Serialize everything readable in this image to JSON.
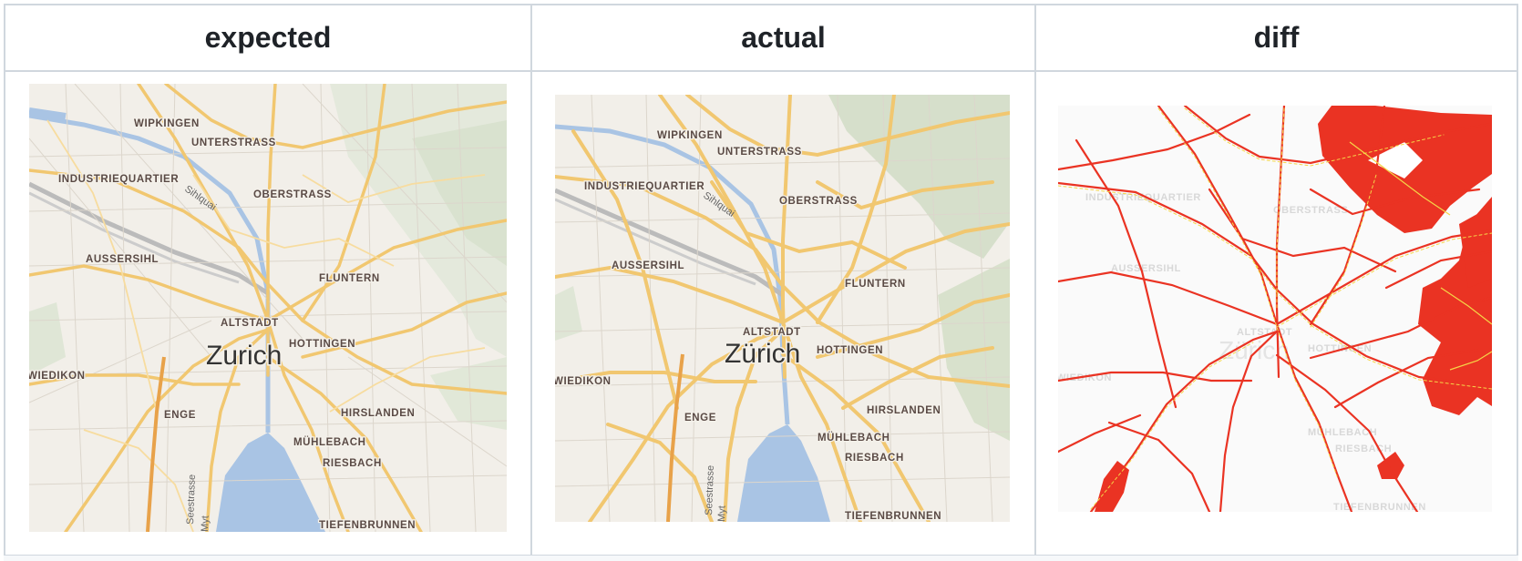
{
  "columns": [
    {
      "id": "expected",
      "label": "expected"
    },
    {
      "id": "actual",
      "label": "actual"
    },
    {
      "id": "diff",
      "label": "diff"
    }
  ],
  "expected_map": {
    "city": "Zurich",
    "street_labels": [
      "Sihlquai",
      "Seestrasse",
      "Myt"
    ],
    "districts": [
      "WIPKINGEN",
      "UNTERSTRASS",
      "INDUSTRIEQUARTIER",
      "OBERSTRASS",
      "AUSSERSIHL",
      "FLUNTERN",
      "ALTSTADT",
      "HOTTINGEN",
      "WIEDIKON",
      "ENGE",
      "HIRSLANDEN",
      "MÜHLEBACH",
      "RIESBACH",
      "TIEFENBRUNNEN"
    ]
  },
  "actual_map": {
    "city": "Zürich",
    "street_labels": [
      "Sihlquai",
      "Seestrasse",
      "Myt"
    ],
    "districts": [
      "WIPKINGEN",
      "UNTERSTRASS",
      "INDUSTRIEQUARTIER",
      "OBERSTRASS",
      "AUSSERSIHL",
      "FLUNTERN",
      "ALTSTADT",
      "HOTTINGEN",
      "WIEDIKON",
      "ENGE",
      "HIRSLANDEN",
      "MÜHLEBACH",
      "RIESBACH",
      "TIEFENBRUNNEN"
    ]
  },
  "diff_map": {
    "city": "Zürich",
    "districts": [
      "INDUSTRIEQUARTIER",
      "OBERSTRASS",
      "AUSSERSIHL",
      "ALTSTADT",
      "HOTTINGEN",
      "WIEDIKON",
      "MÜHLEBACH",
      "RIESBACH",
      "TIEFENBRUNNEN"
    ]
  },
  "colors": {
    "land": "#f2efe9",
    "road": "#f1c770",
    "road_edge": "#e3b35a",
    "water": "#a9c4e4",
    "forest": "#d5dfcc",
    "diff_red": "#ea3323",
    "diff_yellow": "#f5d547",
    "border": "#d0d7de"
  }
}
